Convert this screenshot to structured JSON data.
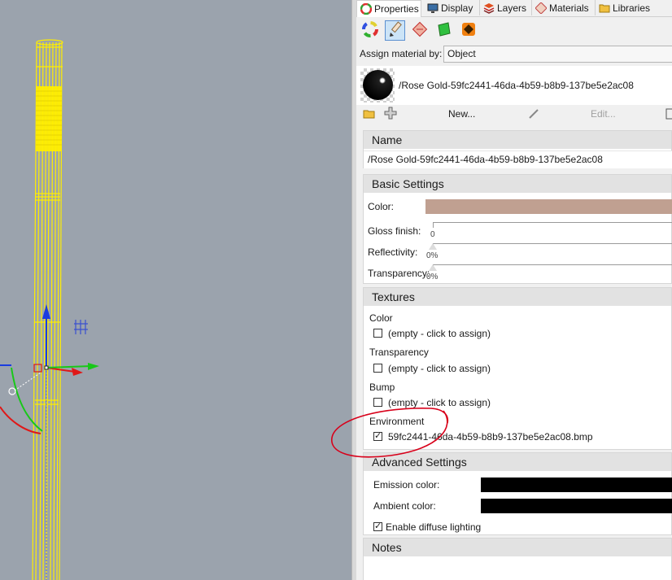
{
  "tabs": [
    {
      "label": "Properties",
      "icon": "color-wheel-icon"
    },
    {
      "label": "Display",
      "icon": "monitor-icon"
    },
    {
      "label": "Layers",
      "icon": "layers-icon"
    },
    {
      "label": "Materials",
      "icon": "materials-icon"
    },
    {
      "label": "Libraries",
      "icon": "folder-icon"
    }
  ],
  "assign": {
    "label": "Assign material by:",
    "value": "Object"
  },
  "preview": {
    "name": "/Rose Gold-59fc2441-46da-4b59-b8b9-137be5e2ac08"
  },
  "library": {
    "new_label": "New...",
    "edit_label": "Edit..."
  },
  "name_section": {
    "title": "Name",
    "value": "/Rose Gold-59fc2441-46da-4b59-b8b9-137be5e2ac08"
  },
  "basic": {
    "title": "Basic Settings",
    "color_label": "Color:",
    "color": "#c0a091",
    "gloss_label": "Gloss finish:",
    "gloss_value": "0",
    "reflectivity_label": "Reflectivity:",
    "reflectivity_value": "0%",
    "transparency_label": "Transparency:",
    "transparency_value": "0%"
  },
  "textures": {
    "title": "Textures",
    "items": [
      {
        "label": "Color",
        "value": "(empty - click to assign)",
        "checked": false
      },
      {
        "label": "Transparency",
        "value": "(empty - click to assign)",
        "checked": false
      },
      {
        "label": "Bump",
        "value": "(empty - click to assign)",
        "checked": false
      },
      {
        "label": "Environment",
        "value": "59fc2441-46da-4b59-b8b9-137be5e2ac08.bmp",
        "checked": true
      }
    ]
  },
  "advanced": {
    "title": "Advanced Settings",
    "emission_label": "Emission color:",
    "emission_color": "#000000",
    "ambient_label": "Ambient color:",
    "ambient_color": "#000000",
    "diffuse_label": "Enable diffuse lighting",
    "diffuse_checked": true
  },
  "notes": {
    "title": "Notes"
  },
  "colors": {
    "accent": "#5a8fd0",
    "wireframe": "#ffee00",
    "annotation": "#d8001a"
  }
}
